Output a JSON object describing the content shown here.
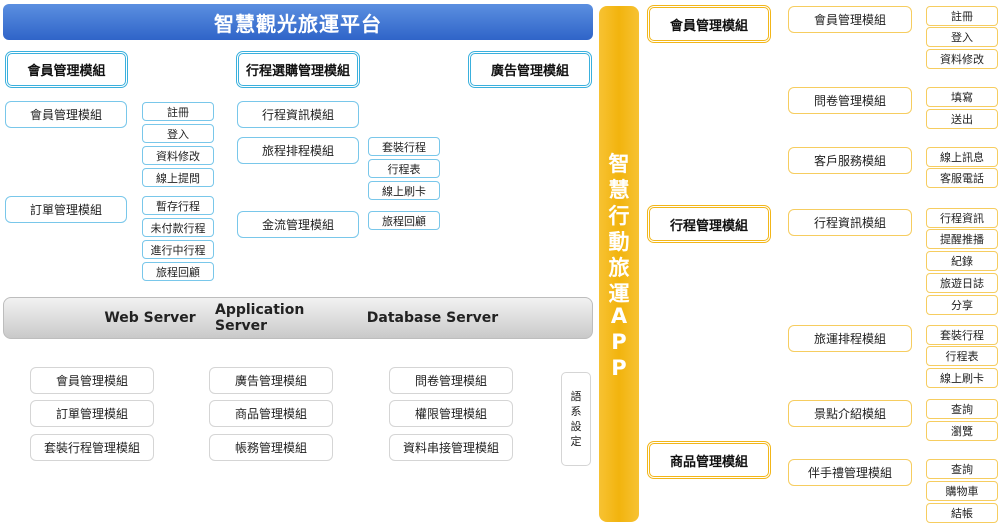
{
  "title": "智慧觀光旅運平台",
  "web_platform": {
    "headers": {
      "member": "會員管理模組",
      "trip": "行程選購管理模組",
      "ad": "廣告管理模組"
    },
    "member_col": {
      "member_module": "會員管理模組",
      "member_items": [
        "註冊",
        "登入",
        "資料修改",
        "線上提問"
      ],
      "order_module": "訂單管理模組",
      "order_items": [
        "暫存行程",
        "未付款行程",
        "進行中行程",
        "旅程回顧"
      ]
    },
    "trip_col": {
      "info_module": "行程資訊模組",
      "schedule_module": "旅程排程模組",
      "schedule_items": [
        "套裝行程",
        "行程表",
        "線上刷卡"
      ],
      "payment_module": "金流管理模組",
      "payment_items": [
        "旅程回顧"
      ]
    }
  },
  "servers": [
    "Web Server",
    "Application Server",
    "Database Server"
  ],
  "backend": {
    "col1": [
      "會員管理模組",
      "訂單管理模組",
      "套裝行程管理模組"
    ],
    "col2": [
      "廣告管理模組",
      "商品管理模組",
      "帳務管理模組"
    ],
    "col3": [
      "問卷管理模組",
      "權限管理模組",
      "資料串接管理模組"
    ],
    "language": [
      "語",
      "系",
      "設",
      "定"
    ]
  },
  "app": {
    "title_chars": [
      "智",
      "慧",
      "行",
      "動",
      "旅",
      "運",
      "A",
      "P",
      "P"
    ],
    "headers": {
      "member": "會員管理模組",
      "trip": "行程管理模組",
      "goods": "商品管理模組"
    },
    "modules": {
      "member": {
        "label": "會員管理模組",
        "items": [
          "註冊",
          "登入",
          "資料修改"
        ]
      },
      "survey": {
        "label": "問卷管理模組",
        "items": [
          "填寫",
          "送出"
        ]
      },
      "service": {
        "label": "客戶服務模組",
        "items": [
          "線上訊息",
          "客服電話"
        ]
      },
      "trip_info": {
        "label": "行程資訊模組",
        "items": [
          "行程資訊",
          "提醒推播",
          "紀錄",
          "旅遊日誌",
          "分享"
        ]
      },
      "schedule": {
        "label": "旅運排程模組",
        "items": [
          "套裝行程",
          "行程表",
          "線上刷卡"
        ]
      },
      "attraction": {
        "label": "景點介紹模組",
        "items": [
          "查詢",
          "瀏覽"
        ]
      },
      "gift": {
        "label": "伴手禮管理模組",
        "items": [
          "查詢",
          "購物車",
          "結帳"
        ]
      }
    }
  },
  "colors": {
    "blue_accent": "#3ab0dd",
    "yellow_accent": "#f2b619",
    "title_bar": "#2f64c8"
  }
}
